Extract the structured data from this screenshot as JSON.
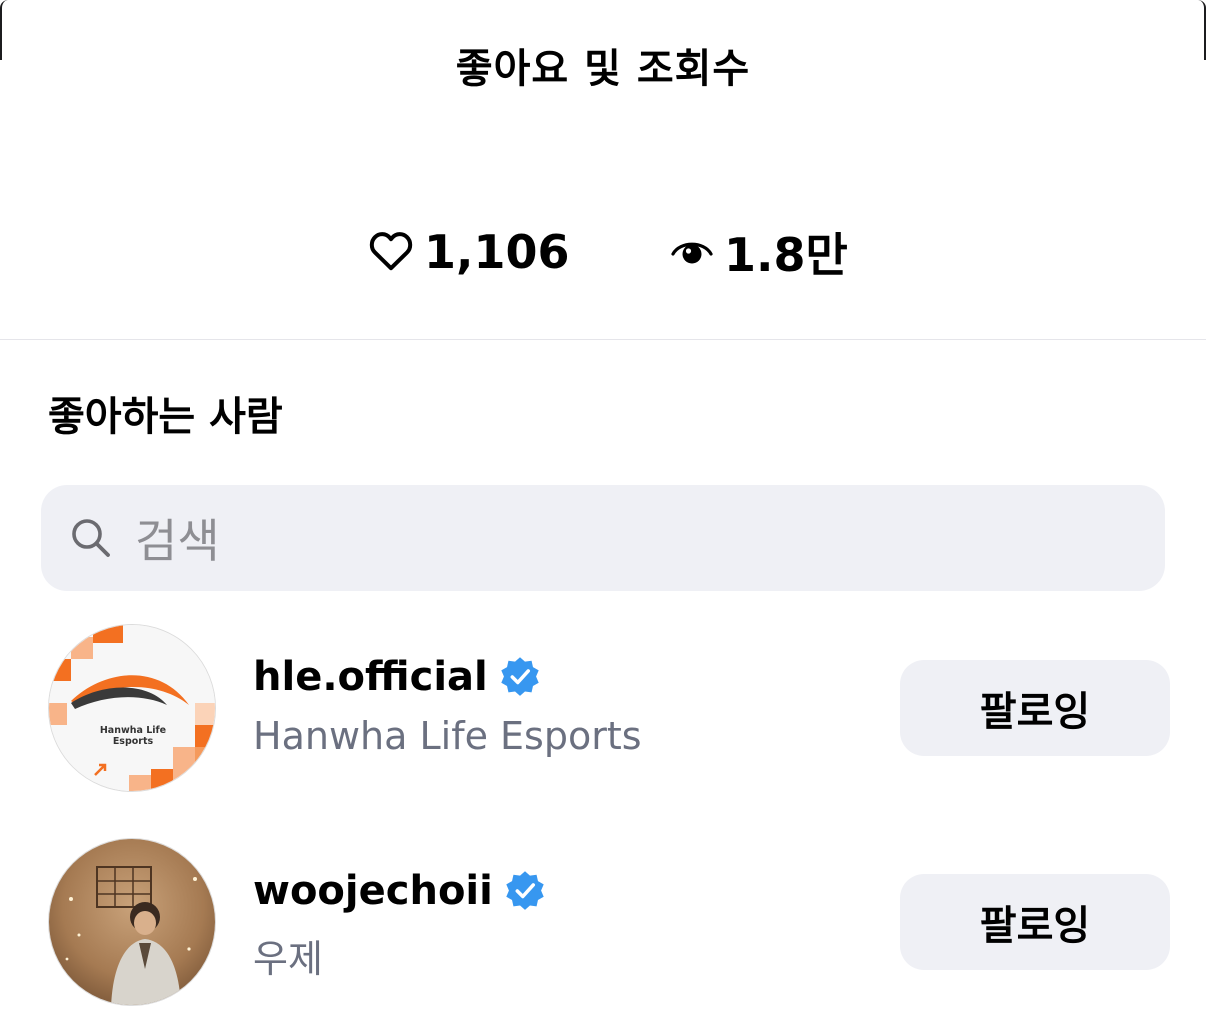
{
  "header": {
    "title": "좋아요 및 조회수"
  },
  "stats": {
    "likes": "1,106",
    "views": "1.8만",
    "likes_icon": "heart-icon",
    "views_icon": "eye-icon"
  },
  "likers": {
    "title": "좋아하는 사람",
    "search_placeholder": "검색",
    "items": [
      {
        "username": "hle.official",
        "display_name": "Hanwha Life Esports",
        "verified": true,
        "button_label": "팔로잉",
        "avatar_text": "Hanwha Life Esports"
      },
      {
        "username": "woojechoii",
        "display_name": "우제",
        "verified": true,
        "button_label": "팔로잉"
      }
    ]
  },
  "colors": {
    "verified": "#3797f0",
    "muted_text": "#6b7080",
    "button_bg": "#eff0f5",
    "brand_orange": "#f37021"
  }
}
